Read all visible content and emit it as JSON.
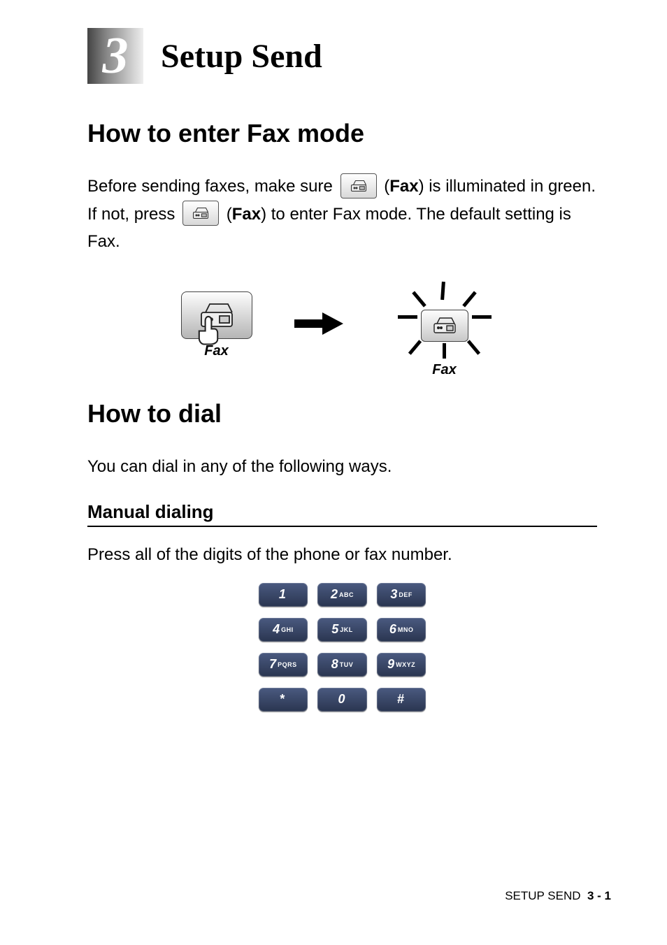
{
  "chapter": {
    "number": "3",
    "title": "Setup Send"
  },
  "section1": {
    "heading": "How to enter Fax mode",
    "p_part1": "Before sending faxes, make sure ",
    "p_part2_prefix": " (",
    "p_part2_bold": "Fax",
    "p_part2_suffix": ") is illuminated in green. If not, press ",
    "p_part3_prefix": " (",
    "p_part3_bold": "Fax",
    "p_part3_suffix": ") to enter Fax mode. The default setting is Fax.",
    "key_label_left": "Fax",
    "key_label_right": "Fax"
  },
  "section2": {
    "heading": "How to dial",
    "intro": "You can dial in any of the following ways.",
    "sub_heading": "Manual dialing",
    "sub_text": "Press all of the digits of the phone or fax number.",
    "keypad": [
      {
        "digit": "1",
        "letters": ""
      },
      {
        "digit": "2",
        "letters": "ABC"
      },
      {
        "digit": "3",
        "letters": "DEF"
      },
      {
        "digit": "4",
        "letters": "GHI"
      },
      {
        "digit": "5",
        "letters": "JKL"
      },
      {
        "digit": "6",
        "letters": "MNO"
      },
      {
        "digit": "7",
        "letters": "PQRS"
      },
      {
        "digit": "8",
        "letters": "TUV"
      },
      {
        "digit": "9",
        "letters": "WXYZ"
      },
      {
        "digit": "*",
        "letters": ""
      },
      {
        "digit": "0",
        "letters": ""
      },
      {
        "digit": "#",
        "letters": ""
      }
    ]
  },
  "footer": {
    "section": "SETUP SEND",
    "page": "3 - 1"
  }
}
